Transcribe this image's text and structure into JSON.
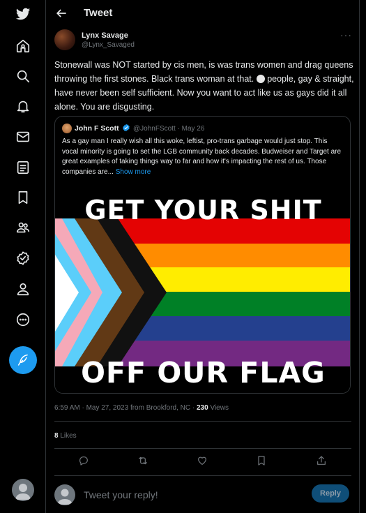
{
  "header": {
    "title": "Tweet"
  },
  "tweet": {
    "author_name": "Lynx Savage",
    "author_handle": "@Lynx_Savaged",
    "text_part1": "Stonewall was NOT started by cis men, is was trans women and drag queens throwing the first stones. Black trans woman at that. ",
    "text_part2": " people, gay & straight, have never been self sufficient. Now you want to act like us as gays did it all alone. You are disgusting.",
    "timestamp": "6:59 AM · May 27, 2023 from Brookford, NC · ",
    "views_count": "230",
    "views_label": " Views",
    "likes_count": "8",
    "likes_label": " Likes"
  },
  "quote": {
    "author_name": "John F Scott",
    "handle_date": "@JohnFScott · May 26",
    "text": "As a gay man I really wish all this woke, leftist, pro-trans garbage would just stop. This vocal minority is going to set the LGB community back decades. Budweiser and Target are great examples of taking things way to far and how it's impacting the rest of us. Those companies are... ",
    "show_more": "Show more",
    "image_text_top": "GET YOUR SHIT",
    "image_text_bottom": "OFF OUR FLAG"
  },
  "reply": {
    "placeholder": "Tweet your reply!",
    "button_label": "Reply"
  },
  "colors": {
    "accent": "#1d9bf0",
    "background": "#000000",
    "flag_red": "#e40303",
    "flag_orange": "#ff8c00",
    "flag_yellow": "#ffed00",
    "flag_green": "#008026",
    "flag_blue": "#24408e",
    "flag_purple": "#732982"
  },
  "icons": [
    "twitter-logo-icon",
    "home-icon",
    "explore-icon",
    "notifications-icon",
    "messages-icon",
    "lists-icon",
    "bookmarks-icon",
    "communities-icon",
    "verified-icon",
    "profile-icon",
    "more-icon",
    "compose-icon",
    "back-arrow-icon",
    "more-options-icon",
    "reply-icon",
    "retweet-icon",
    "like-icon",
    "bookmark-icon",
    "share-icon"
  ]
}
